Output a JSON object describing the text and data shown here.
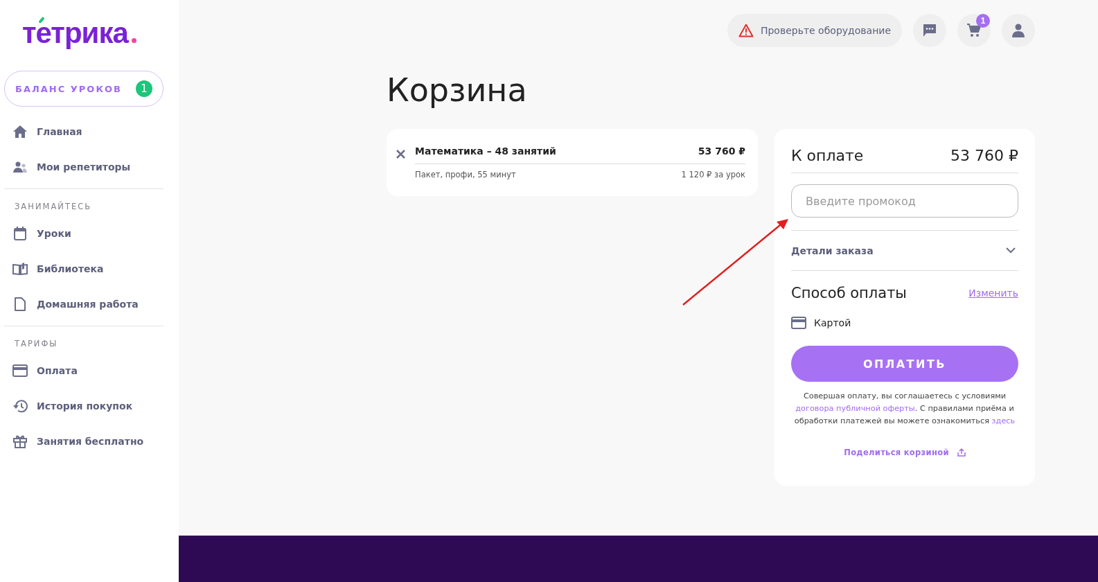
{
  "logo": {
    "text": "тетрика"
  },
  "balance": {
    "label": "БАЛАНС УРОКОВ",
    "count": "1"
  },
  "sidebar": {
    "groups": [
      {
        "items": [
          {
            "label": "Главная",
            "kind": "home"
          },
          {
            "label": "Мои репетиторы",
            "kind": "people"
          }
        ]
      },
      {
        "heading": "ЗАНИМАЙТЕСЬ",
        "items": [
          {
            "label": "Уроки",
            "kind": "calendar"
          },
          {
            "label": "Библиотека",
            "kind": "book"
          },
          {
            "label": "Домашняя работа",
            "kind": "file"
          }
        ]
      },
      {
        "heading": "ТАРИФЫ",
        "items": [
          {
            "label": "Оплата",
            "kind": "card"
          },
          {
            "label": "История покупок",
            "kind": "history"
          },
          {
            "label": "Занятия бесплатно",
            "kind": "gift"
          }
        ]
      }
    ]
  },
  "topbar": {
    "equipment_check": "Проверьте оборудование",
    "cart_count": "1"
  },
  "page_title": "Корзина",
  "cart_items": [
    {
      "title": "Математика – 48 занятий",
      "price": "53 760 ₽",
      "details": "Пакет, профи, 55 минут",
      "unit_price": "1 120 ₽ за урок"
    }
  ],
  "summary": {
    "total_label": "К оплате",
    "total": "53 760 ₽",
    "promo": {
      "placeholder": "Введите промокод"
    },
    "order_details": "Детали заказа",
    "order_details_expanded": false,
    "payment_title": "Способ оплаты",
    "change_link": "Изменить",
    "payment_method": "Картой",
    "pay_button": "ОПЛАТИТЬ",
    "terms": [
      {
        "kind": "text",
        "text": "Совершая оплату, вы соглашаетесь с условиями "
      },
      {
        "kind": "link",
        "text": "договора публичной оферты"
      },
      {
        "kind": "text",
        "text": ". С правилами приёма и обработки платежей вы можете ознакомиться "
      },
      {
        "kind": "link",
        "text": "здесь"
      }
    ],
    "share": "Поделиться корзиной"
  }
}
